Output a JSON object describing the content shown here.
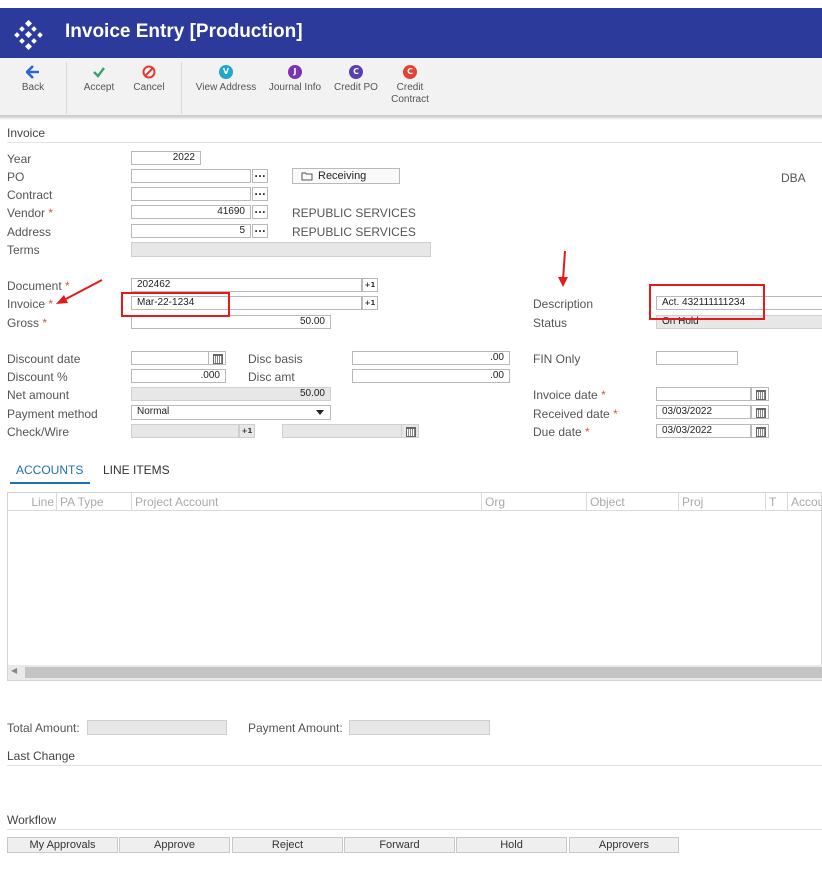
{
  "app": {
    "title": "Invoice Entry [Production]"
  },
  "toolbar": {
    "back": "Back",
    "accept": "Accept",
    "cancel": "Cancel",
    "view_address": "View Address",
    "journal_info": "Journal Info",
    "credit_po": "Credit PO",
    "credit_contract_1": "Credit",
    "credit_contract_2": "Contract",
    "glyph_v": "V",
    "glyph_j": "J",
    "glyph_c": "C",
    "colors": {
      "back": "#2f66c8",
      "accept": "#3ca06b",
      "cancel": "#e03c31",
      "view_address": "#22a7c9",
      "journal_info": "#7b35b3",
      "credit_po": "#5a3fb3",
      "credit_contract": "#e04433"
    }
  },
  "invoice_section": {
    "title": "Invoice",
    "year_label": "Year",
    "year_value": "2022",
    "po_label": "PO",
    "po_value": "",
    "receiving_label": "Receiving",
    "contract_label": "Contract",
    "contract_value": "",
    "dba_label": "DBA",
    "vendor_label": "Vendor",
    "vendor_value": "41690",
    "vendor_name": "REPUBLIC SERVICES",
    "address_label": "Address",
    "address_value": "5",
    "address_name": "REPUBLIC SERVICES",
    "terms_label": "Terms",
    "terms_value": "",
    "ellipsis": "...",
    "plus_one": "+1",
    "required_mark": "*",
    "document_label": "Document",
    "document_value": "202462",
    "invoice_label": "Invoice",
    "invoice_value": "Mar-22-1234",
    "gross_label": "Gross",
    "gross_value": "50.00",
    "description_label": "Description",
    "description_value": "Act. 432111111234",
    "status_label": "Status",
    "status_value": "On Hold",
    "discount_date_label": "Discount date",
    "discount_date_value": "",
    "discount_pct_label": "Discount %",
    "discount_pct_value": ".000",
    "net_amount_label": "Net amount",
    "net_amount_value": "50.00",
    "payment_method_label": "Payment method",
    "payment_method_value": "Normal",
    "check_wire_label": "Check/Wire",
    "check_wire_value": "",
    "disc_basis_label": "Disc basis",
    "disc_basis_value": ".00",
    "disc_amt_label": "Disc amt",
    "disc_amt_value": ".00",
    "fin_only_label": "FIN Only",
    "fin_only_value": "",
    "invoice_date_label": "Invoice date",
    "invoice_date_value": "",
    "received_date_label": "Received date",
    "received_date_value": "03/03/2022",
    "due_date_label": "Due date",
    "due_date_value": "03/03/2022"
  },
  "tabs": {
    "accounts": "ACCOUNTS",
    "line_items": "LINE ITEMS",
    "active_color": "#1f6fb5"
  },
  "grid": {
    "columns": [
      "Line",
      "PA Type",
      "Project Account",
      "Org",
      "Object",
      "Proj",
      "T",
      "Accou"
    ]
  },
  "totals": {
    "total_amount_label": "Total Amount:",
    "total_amount_value": "",
    "payment_amount_label": "Payment Amount:",
    "payment_amount_value": ""
  },
  "last_change": {
    "title": "Last Change"
  },
  "workflow": {
    "title": "Workflow",
    "my_approvals": "My Approvals",
    "approve": "Approve",
    "reject": "Reject",
    "forward": "Forward",
    "hold": "Hold",
    "approvers": "Approvers"
  },
  "annotations": {
    "highlight_color": "#e31b1b"
  }
}
